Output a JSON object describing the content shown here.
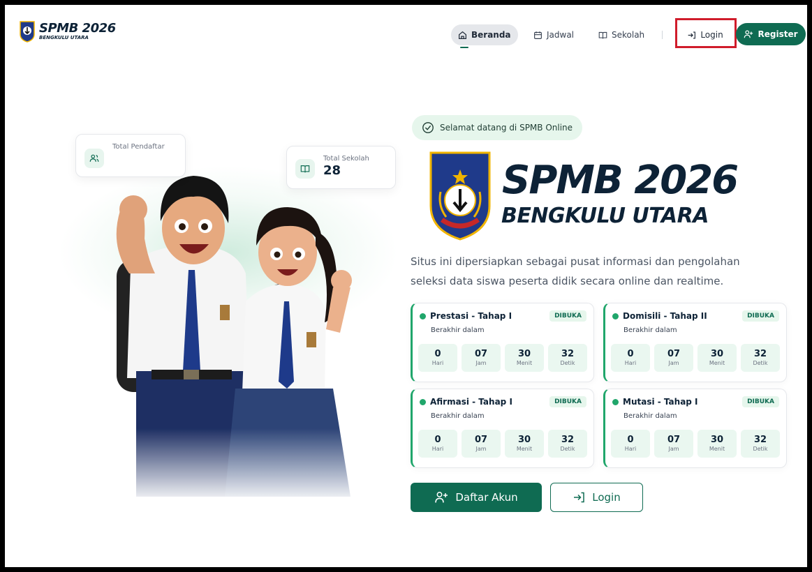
{
  "brand": {
    "title": "SPMB 2026",
    "subtitle": "BENGKULU UTARA",
    "logo": "kabupaten-emblem"
  },
  "nav": {
    "items": [
      {
        "label": "Beranda",
        "icon": "home-icon",
        "active": true
      },
      {
        "label": "Jadwal",
        "icon": "calendar-icon",
        "active": false
      },
      {
        "label": "Sekolah",
        "icon": "book-icon",
        "active": false
      }
    ],
    "login_label": "Login",
    "register_label": "Register"
  },
  "stats": {
    "pendaftar": {
      "label": "Total Pendaftar",
      "value": ""
    },
    "sekolah": {
      "label": "Total Sekolah",
      "value": "28"
    }
  },
  "hero": {
    "welcome": "Selamat datang di SPMB Online",
    "title": "SPMB 2026",
    "subtitle": "BENGKULU UTARA",
    "description": "Situs ini dipersiapkan sebagai pusat informasi dan pengolahan seleksi data siswa peserta didik secara online dan realtime."
  },
  "schedules": [
    {
      "title": "Prestasi - Tahap I",
      "status": "DIBUKA",
      "sub": "Berakhir dalam",
      "timer": [
        {
          "value": "0",
          "label": "Hari"
        },
        {
          "value": "07",
          "label": "Jam"
        },
        {
          "value": "30",
          "label": "Menit"
        },
        {
          "value": "32",
          "label": "Detik"
        }
      ]
    },
    {
      "title": "Domisili - Tahap II",
      "status": "DIBUKA",
      "sub": "Berakhir dalam",
      "timer": [
        {
          "value": "0",
          "label": "Hari"
        },
        {
          "value": "07",
          "label": "Jam"
        },
        {
          "value": "30",
          "label": "Menit"
        },
        {
          "value": "32",
          "label": "Detik"
        }
      ]
    },
    {
      "title": "Afirmasi - Tahap I",
      "status": "DIBUKA",
      "sub": "Berakhir dalam",
      "timer": [
        {
          "value": "0",
          "label": "Hari"
        },
        {
          "value": "07",
          "label": "Jam"
        },
        {
          "value": "30",
          "label": "Menit"
        },
        {
          "value": "32",
          "label": "Detik"
        }
      ]
    },
    {
      "title": "Mutasi - Tahap I",
      "status": "DIBUKA",
      "sub": "Berakhir dalam",
      "timer": [
        {
          "value": "0",
          "label": "Hari"
        },
        {
          "value": "07",
          "label": "Jam"
        },
        {
          "value": "30",
          "label": "Menit"
        },
        {
          "value": "32",
          "label": "Detik"
        }
      ]
    }
  ],
  "cta": {
    "primary": "Daftar Akun",
    "secondary": "Login"
  },
  "colors": {
    "primary": "#0f6b52",
    "accent": "#20a66b",
    "highlight": "#d01c2b",
    "title": "#0d2236"
  }
}
